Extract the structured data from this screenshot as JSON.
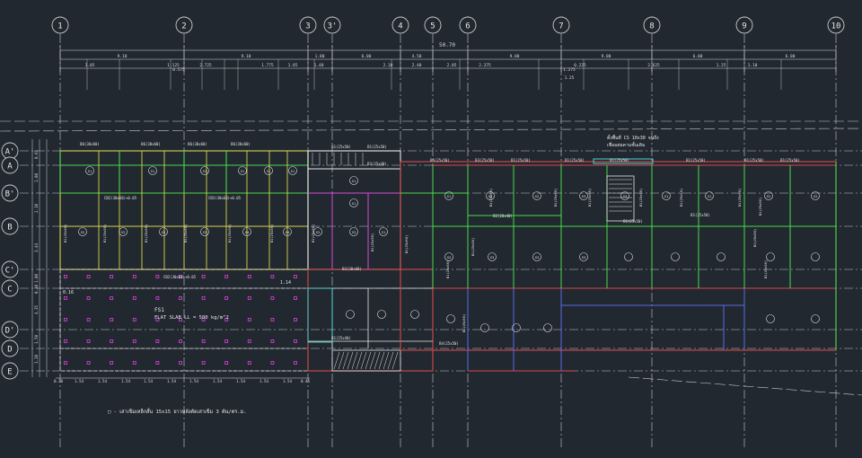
{
  "grid_columns": [
    "1",
    "2",
    "3",
    "3'",
    "4",
    "5",
    "6",
    "7",
    "8",
    "9",
    "10"
  ],
  "grid_rows": [
    "A'",
    "A",
    "B'",
    "B",
    "C'",
    "C",
    "D'",
    "D",
    "E"
  ],
  "overall_dim": "50.70",
  "top_dims_row1": [
    "9.10",
    "9.10",
    "1.80",
    "6.00",
    "4.50",
    "9.00",
    "9.00",
    "6.00",
    "6.00"
  ],
  "top_dims_row2": [
    "3.05",
    "1.125",
    "2.725",
    "1.775",
    "1.85",
    "1.40",
    "2.10",
    "2.40",
    "2.05",
    "2.375",
    "0.225",
    "2.625",
    "1.25",
    "1.10"
  ],
  "top_dims_row3": [
    "0.575",
    "1.275",
    "1.25"
  ],
  "bottom_dims": [
    "0.30",
    "1.54",
    "1.54",
    "1.54",
    "1.54",
    "1.54",
    "1.54",
    "1.54",
    "1.54",
    "1.54",
    "1.54",
    "0.45"
  ],
  "left_dims": [
    "0.65",
    "1.80",
    "2.10",
    "3.44",
    "1.80",
    "0.30",
    "4.35",
    "1.50",
    "1.20"
  ],
  "beam_labels": [
    "B6(30x60)",
    "B6(30x60)",
    "B6(30x60)",
    "B6(30x60)",
    "B1(25x50)",
    "B1(25x50)",
    "B5(25x50)",
    "B3(25x50)",
    "B1(25x50)",
    "B1(25x50)",
    "B1(25x50)",
    "B1(25x50)",
    "B1(25x50)",
    "B1(25x50)",
    "B1(25x50)",
    "B1(25x50)",
    "B3(30x60)",
    "B1(25x40)",
    "CB2(30x60)+0.05",
    "CB3(30x60)+0.05",
    "CB2(30x60)+0.05",
    "B2(20x40)",
    "B3(25x40)",
    "B4(25x50)"
  ],
  "slab_labels": [
    "S1",
    "S1",
    "S1",
    "S1",
    "S1",
    "S1",
    "S1",
    "S1",
    "S2",
    "S2",
    "S3",
    "S3",
    "S4",
    "S4",
    "S2",
    "S3",
    "S1",
    "S1",
    "S2",
    "S2",
    "S3",
    "S3",
    "S1",
    "S1",
    "S2",
    "S2",
    "S2",
    "S3",
    "S3",
    "S3"
  ],
  "flat_slab_label": "FS1",
  "flat_slab_note": "FLAT SLAB LL = 500 kg/m^2",
  "stair_note_1": "ตั้งพื้นที่ CS 10x30 จนถึง",
  "stair_note_2": "เชื่อมต่อคานชั้นเดิม",
  "dim_114": "1.14",
  "dim_016": "0.16",
  "legend_text": "□ - เสาเข็มเหล็กสั้น 15x15 ยาวหลังตัดเสาเข็ม 3 ต้น/ตร.ม.",
  "colors": {
    "background": "#212830",
    "grid_line": "#c8ccd0",
    "dim_line": "#d8dade",
    "beam_yellow": "#d8d44a",
    "beam_green": "#4ad84a",
    "beam_red": "#d84a4a",
    "beam_blue": "#5a6ae8",
    "beam_magenta": "#d84ad8",
    "beam_cyan": "#4ad8d8",
    "beam_white": "#e8e8e8",
    "pile_magenta": "#e040e0"
  }
}
